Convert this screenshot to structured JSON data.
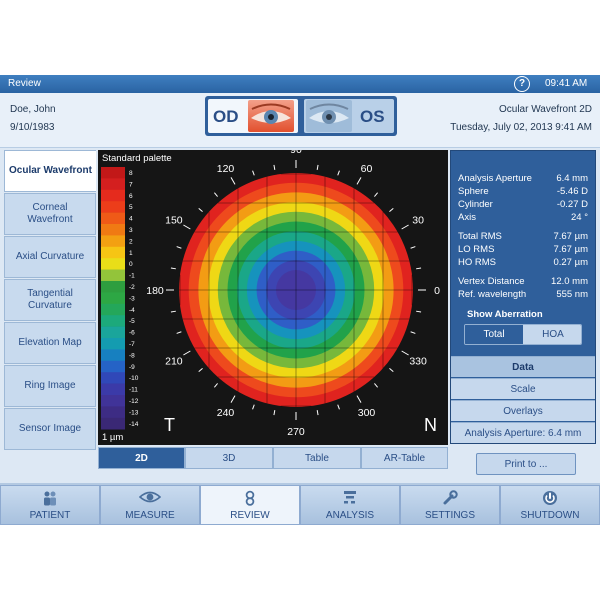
{
  "titlebar": {
    "title": "Review",
    "help": "?",
    "time": "09:41 AM"
  },
  "patient": {
    "name": "Doe, John",
    "dob": "9/10/1983"
  },
  "eye_selector": {
    "od": "OD",
    "os": "OS"
  },
  "exam": {
    "type": "Ocular Wavefront 2D",
    "datetime": "Tuesday, July 02, 2013 9:41 AM"
  },
  "left_tabs": [
    {
      "label": "Ocular Wavefront"
    },
    {
      "label": "Corneal Wavefront"
    },
    {
      "label": "Axial Curvature"
    },
    {
      "label": "Tangential Curvature"
    },
    {
      "label": "Elevation Map"
    },
    {
      "label": "Ring Image"
    },
    {
      "label": "Sensor Image"
    }
  ],
  "map": {
    "palette_title": "Standard palette",
    "unit": "1 µm",
    "scale_values": [
      "8",
      "7",
      "6",
      "5",
      "4",
      "3",
      "2",
      "1",
      "0",
      "-1",
      "-2",
      "-3",
      "-4",
      "-5",
      "-6",
      "-7",
      "-8",
      "-9",
      "-10",
      "-11",
      "-12",
      "-13",
      "-14"
    ],
    "scale_colors": [
      "#c21818",
      "#d41f1f",
      "#e52b1d",
      "#ec3d1a",
      "#ef5a17",
      "#f07a13",
      "#f3a012",
      "#f6c514",
      "#e9de18",
      "#93c43a",
      "#2e9e3f",
      "#2da744",
      "#24a75a",
      "#1ca97b",
      "#1aa59b",
      "#149cb0",
      "#1780c0",
      "#2563c6",
      "#3048b8",
      "#3b3aa8",
      "#403398",
      "#3d2c84",
      "#3a2875"
    ],
    "angles": [
      "90",
      "60",
      "30",
      "0",
      "330",
      "300",
      "270",
      "240",
      "210",
      "180",
      "150",
      "120"
    ],
    "corner_t": "T",
    "corner_n": "N",
    "rings": [
      "#e0231f",
      "#ee4a1d",
      "#f39c14",
      "#efd815",
      "#77b83b",
      "#21a24a",
      "#1aa788",
      "#1693bd",
      "#2f5ec7",
      "#3d45b2",
      "#4538a1"
    ]
  },
  "bottom_tabs": [
    {
      "label": "2D",
      "active": true
    },
    {
      "label": "3D",
      "active": false
    },
    {
      "label": "Table",
      "active": false
    },
    {
      "label": "AR-Table",
      "active": false
    }
  ],
  "analysis": {
    "rows": [
      {
        "label": "Analysis Aperture",
        "value": "6.4 mm"
      },
      {
        "label": "Sphere",
        "value": "-5.46 D"
      },
      {
        "label": "Cylinder",
        "value": "-0.27 D"
      },
      {
        "label": "Axis",
        "value": "24 °"
      },
      {
        "label": "Total RMS",
        "value": "7.67 µm"
      },
      {
        "label": "LO RMS",
        "value": "7.67 µm"
      },
      {
        "label": "HO RMS",
        "value": "0.27 µm"
      },
      {
        "label": "Vertex Distance",
        "value": "12.0 mm"
      },
      {
        "label": "Ref. wavelength",
        "value": "555 nm"
      }
    ],
    "show_aberration": "Show Aberration",
    "toggle_total": "Total",
    "toggle_hoa": "HOA",
    "data_btn": "Data",
    "scale_btn": "Scale",
    "overlays_btn": "Overlays",
    "aperture_btn": "Analysis Aperture: 6.4 mm"
  },
  "print_btn": "Print to ...",
  "nav": [
    {
      "label": "PATIENT",
      "icon": "patient-icon",
      "active": false
    },
    {
      "label": "MEASURE",
      "icon": "eye-icon",
      "active": false
    },
    {
      "label": "REVIEW",
      "icon": "review-icon",
      "active": true
    },
    {
      "label": "ANALYSIS",
      "icon": "chart-icon",
      "active": false
    },
    {
      "label": "SETTINGS",
      "icon": "wrench-icon",
      "active": false
    },
    {
      "label": "SHUTDOWN",
      "icon": "power-icon",
      "active": false
    }
  ]
}
